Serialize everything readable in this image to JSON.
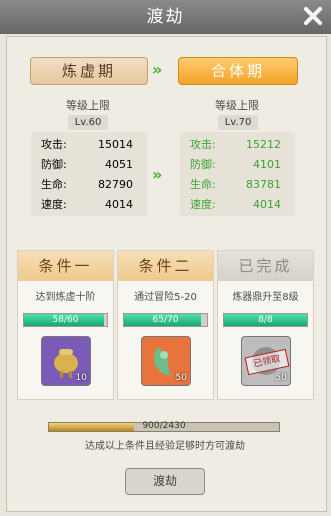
{
  "window": {
    "title": "渡劫"
  },
  "realm": {
    "current": {
      "name": "炼虚期",
      "cap_label": "等级上限",
      "cap": "Lv.60",
      "stats": [
        {
          "k": "攻击:",
          "v": "15014"
        },
        {
          "k": "防御:",
          "v": "4051"
        },
        {
          "k": "生命:",
          "v": "82790"
        },
        {
          "k": "速度:",
          "v": "4014"
        }
      ]
    },
    "next": {
      "name": "合体期",
      "cap_label": "等级上限",
      "cap": "Lv.70",
      "stats": [
        {
          "k": "攻击:",
          "v": "15212"
        },
        {
          "k": "防御:",
          "v": "4101"
        },
        {
          "k": "生命:",
          "v": "83781"
        },
        {
          "k": "速度:",
          "v": "4014"
        }
      ]
    },
    "arrow": "»"
  },
  "conditions": [
    {
      "title": "条件一",
      "desc": "达到炼虚十阶",
      "progress_text": "58/60",
      "progress": 0.9667,
      "reward_count": "10"
    },
    {
      "title": "条件二",
      "desc": "通过冒险5-20",
      "progress_text": "65/70",
      "progress": 0.9286,
      "reward_count": "50"
    },
    {
      "title": "已完成",
      "desc": "炼器鼎升至8级",
      "progress_text": "8/8",
      "progress": 1.0,
      "reward_count": "50",
      "stamp": "已领取"
    }
  ],
  "experience": {
    "text": "900/2430",
    "fraction": 0.3704
  },
  "footer": {
    "note": "达成以上条件且经验足够时方可渡劫",
    "action": "渡劫"
  }
}
